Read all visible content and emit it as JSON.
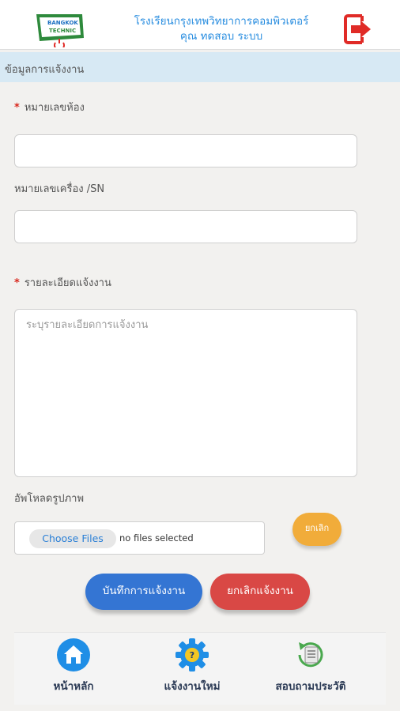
{
  "header": {
    "logo_text_top": "BANGKOK",
    "logo_text_bottom": "TECHNIC",
    "school_name": "โรงเรียนกรุงเทพวิทยาการคอมพิวเตอร์",
    "user_name": "คุณ ทดสอบ ระบบ",
    "logout_icon": "logout-icon",
    "logout_color": "#e02b27"
  },
  "section": {
    "title": "ข้อมูลการแจ้งงาน"
  },
  "form": {
    "room_label": "หมายเลขห้อง",
    "room_value": "",
    "machine_label": "หมายเลขเครื่อง /SN",
    "machine_value": "",
    "detail_label": "รายละเอียดแจ้งงาน",
    "detail_placeholder": "ระบุรายละเอียดการแจ้งงาน",
    "required_mark": "*",
    "upload_label": "อัพโหลดรูปภาพ",
    "choose_files": "Choose Files",
    "no_files": "no files selected",
    "cancel_upload": "ยกเลิก"
  },
  "actions": {
    "save": "บันทึกการแจ้งงาน",
    "cancel": "ยกเลิกแจ้งงาน"
  },
  "nav": {
    "items": [
      {
        "label": "หน้าหลัก",
        "icon": "home-icon"
      },
      {
        "label": "แจ้งงานใหม่",
        "icon": "gear-icon"
      },
      {
        "label": "สอบถามประวัติ",
        "icon": "history-icon"
      }
    ]
  },
  "colors": {
    "accent": "#2a8ee0",
    "save": "#3475d3",
    "cancel": "#d94845",
    "cancel_upload": "#f1ac3a",
    "required": "#d8281e"
  }
}
